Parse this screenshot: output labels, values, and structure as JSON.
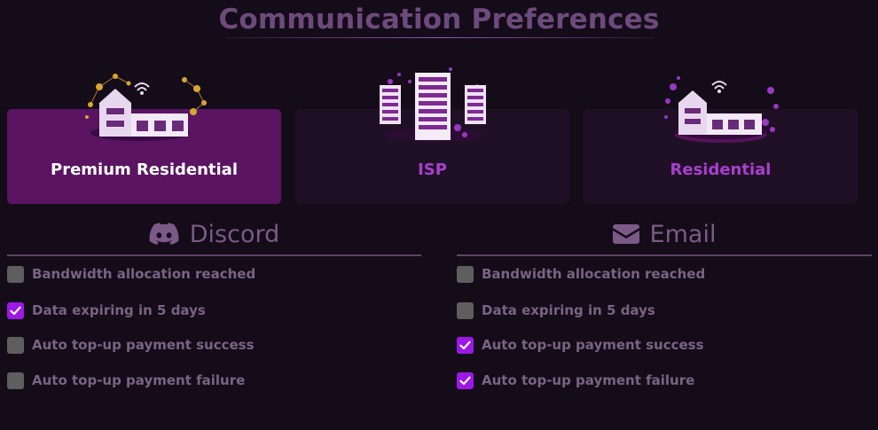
{
  "page": {
    "title": "Communication Preferences"
  },
  "plans": [
    {
      "id": "premium-residential",
      "label": "Premium Residential",
      "selected": true
    },
    {
      "id": "isp",
      "label": "ISP",
      "selected": false
    },
    {
      "id": "residential",
      "label": "Residential",
      "selected": false
    }
  ],
  "discord": {
    "heading": "Discord",
    "icon": "discord-icon",
    "options": [
      {
        "label": "Bandwidth allocation reached",
        "checked": false
      },
      {
        "label": "Data expiring in 5 days",
        "checked": true
      },
      {
        "label": "Auto top-up payment success",
        "checked": false
      },
      {
        "label": "Auto top-up payment failure",
        "checked": false
      }
    ]
  },
  "email": {
    "heading": "Email",
    "icon": "envelope-icon",
    "options": [
      {
        "label": "Bandwidth allocation reached",
        "checked": false
      },
      {
        "label": "Data expiring in 5 days",
        "checked": false
      },
      {
        "label": "Auto top-up payment success",
        "checked": true
      },
      {
        "label": "Auto top-up payment failure",
        "checked": true
      }
    ]
  },
  "colors": {
    "background": "#140c18",
    "accent": "#9c18e6",
    "selected_card": "#5a1462",
    "card": "#1f1025",
    "title": "#6e4a7c"
  }
}
